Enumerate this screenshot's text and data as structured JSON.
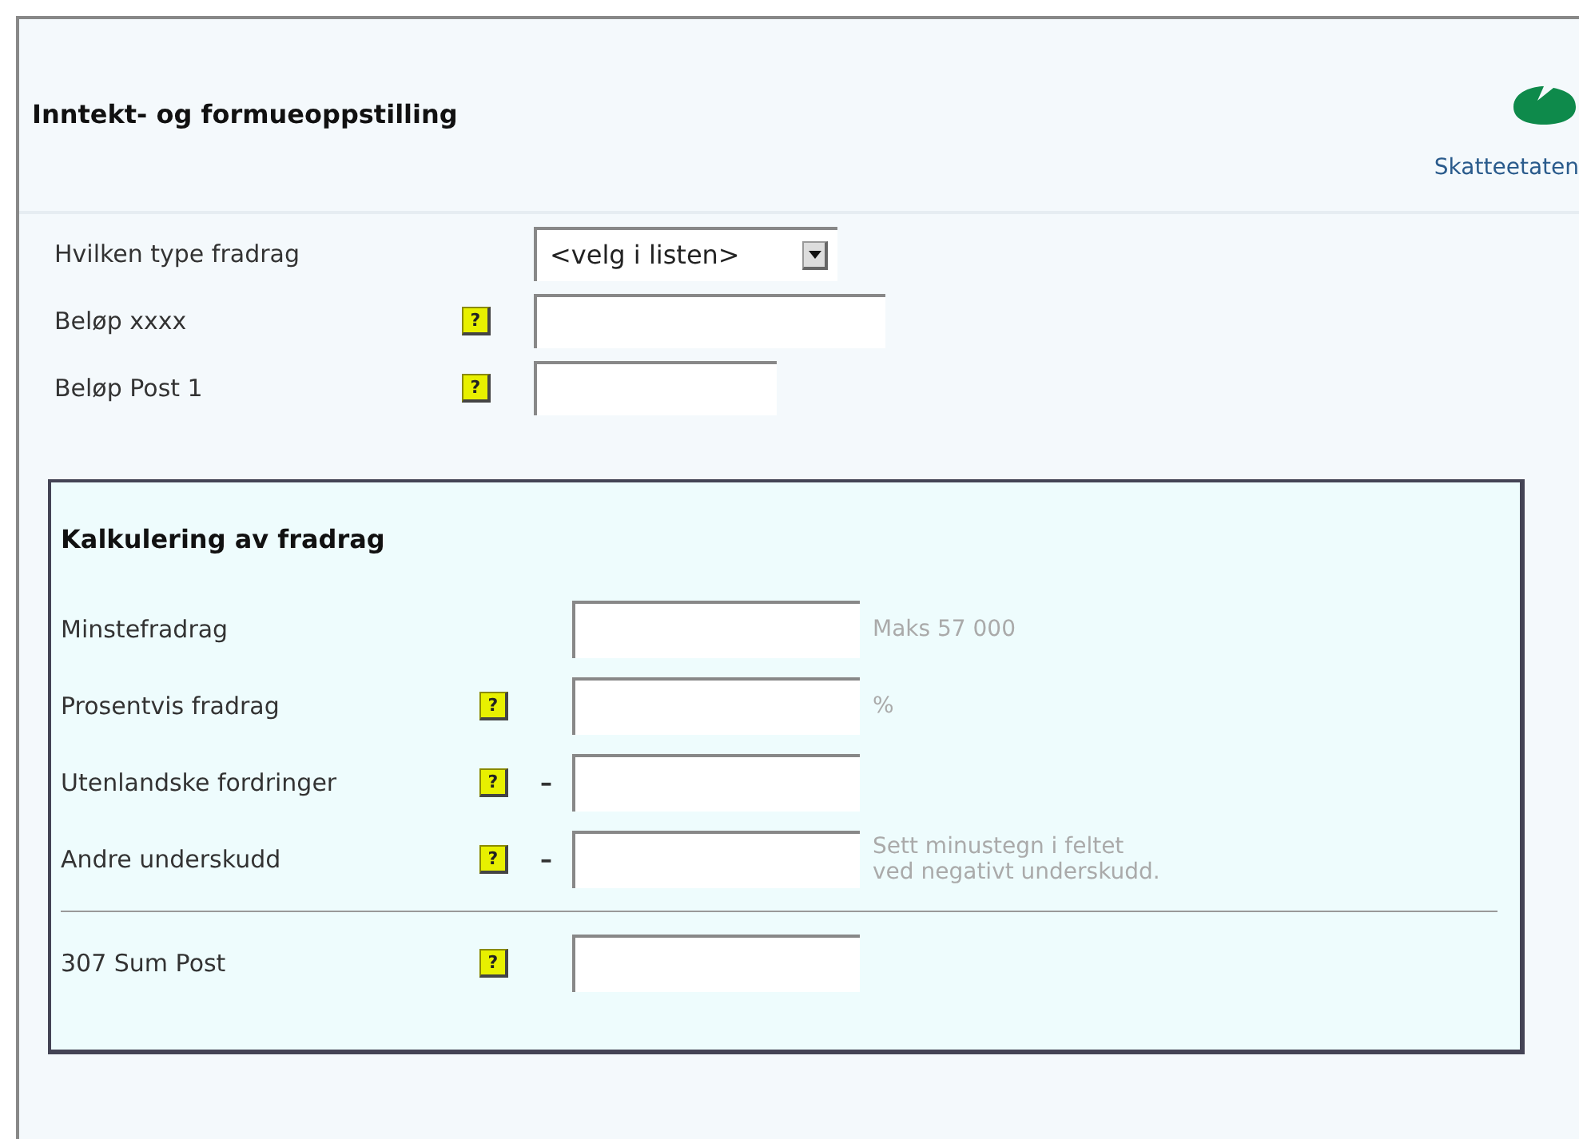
{
  "header": {
    "title": "Inntekt- og formueoppstilling",
    "logo_text": "Skatteetaten"
  },
  "fields": [
    {
      "kind": "select",
      "label": "Hvilken type fradrag",
      "value": "<velg i listen>"
    },
    {
      "kind": "input",
      "label": "Beløp xxxx",
      "help": "?"
    },
    {
      "kind": "input-short",
      "label": "Beløp Post 1",
      "help": "?"
    }
  ],
  "calculation": {
    "title": "Kalkulering av fradrag",
    "rows": [
      {
        "label": "Minstefradrag",
        "note": "Maks 57 000",
        "separator_above": false
      },
      {
        "label": "Prosentvis fradrag",
        "help": "?",
        "note": "%",
        "separator_above": false
      },
      {
        "label": "Utenlandske fordringer",
        "help": "?",
        "sign": "–",
        "separator_above": false
      },
      {
        "label": "Andre underskudd",
        "help": "?",
        "sign": "–",
        "note": "Sett minustegn i feltet\nved negativt underskudd.",
        "separator_above": false
      },
      {
        "label": "307 Sum Post",
        "help": "?",
        "separator_above": true
      }
    ]
  }
}
